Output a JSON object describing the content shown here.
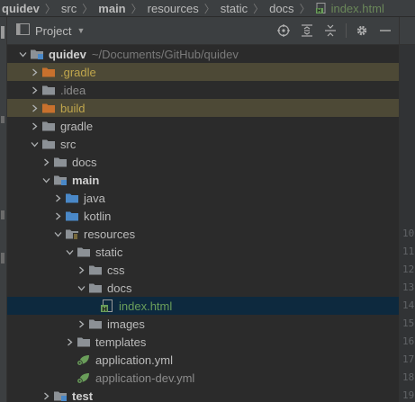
{
  "breadcrumb": {
    "items": [
      "quidev",
      "src",
      "main",
      "resources",
      "static",
      "docs",
      "index.html"
    ]
  },
  "panel": {
    "title": "Project",
    "tools": [
      "locate-icon",
      "expand-all-icon",
      "collapse-all-icon",
      "gear-icon",
      "minimize-icon"
    ]
  },
  "tree": {
    "rows": [
      {
        "label": "quidev",
        "path": "~/Documents/GitHub/quidev",
        "depth": 0,
        "icon": "module-folder-icon",
        "state": "expanded",
        "style": "bold"
      },
      {
        "label": ".gradle",
        "depth": 1,
        "icon": "folder-icon-excluded",
        "state": "collapsed",
        "style": "excluded"
      },
      {
        "label": ".idea",
        "depth": 1,
        "icon": "folder-icon",
        "state": "collapsed",
        "style": "dim"
      },
      {
        "label": "build",
        "depth": 1,
        "icon": "folder-icon-excluded",
        "state": "collapsed",
        "style": "excluded"
      },
      {
        "label": "gradle",
        "depth": 1,
        "icon": "folder-icon",
        "state": "collapsed",
        "style": "normal"
      },
      {
        "label": "src",
        "depth": 1,
        "icon": "folder-icon",
        "state": "expanded",
        "style": "normal"
      },
      {
        "label": "docs",
        "depth": 2,
        "icon": "folder-icon",
        "state": "collapsed",
        "style": "normal"
      },
      {
        "label": "main",
        "depth": 2,
        "icon": "module-folder-icon",
        "state": "expanded",
        "style": "bold"
      },
      {
        "label": "java",
        "depth": 3,
        "icon": "source-folder-icon",
        "state": "collapsed",
        "style": "normal"
      },
      {
        "label": "kotlin",
        "depth": 3,
        "icon": "source-folder-icon",
        "state": "collapsed",
        "style": "normal"
      },
      {
        "label": "resources",
        "depth": 3,
        "icon": "resources-folder-icon",
        "state": "expanded",
        "style": "normal"
      },
      {
        "label": "static",
        "depth": 4,
        "icon": "folder-icon",
        "state": "expanded",
        "style": "normal"
      },
      {
        "label": "css",
        "depth": 5,
        "icon": "folder-icon",
        "state": "collapsed",
        "style": "normal"
      },
      {
        "label": "docs",
        "depth": 5,
        "icon": "folder-icon",
        "state": "expanded",
        "style": "normal"
      },
      {
        "label": "index.html",
        "depth": 6,
        "icon": "html-file-icon",
        "state": "leaf",
        "style": "file-selected"
      },
      {
        "label": "images",
        "depth": 5,
        "icon": "folder-icon",
        "state": "collapsed",
        "style": "normal"
      },
      {
        "label": "templates",
        "depth": 4,
        "icon": "folder-icon",
        "state": "collapsed",
        "style": "normal"
      },
      {
        "label": "application.yml",
        "depth": 4,
        "icon": "spring-config-icon",
        "state": "leaf",
        "style": "normal"
      },
      {
        "label": "application-dev.yml",
        "depth": 4,
        "icon": "spring-config-icon",
        "state": "leaf",
        "style": "dim"
      },
      {
        "label": "test",
        "depth": 2,
        "icon": "module-folder-icon",
        "state": "collapsed",
        "style": "bold"
      }
    ]
  },
  "gutter": {
    "line_numbers": [
      "",
      "",
      "",
      "",
      "",
      "",
      "",
      "",
      "",
      "",
      "10",
      "11",
      "12",
      "13",
      "14",
      "15",
      "16",
      "17",
      "18",
      "19"
    ]
  }
}
